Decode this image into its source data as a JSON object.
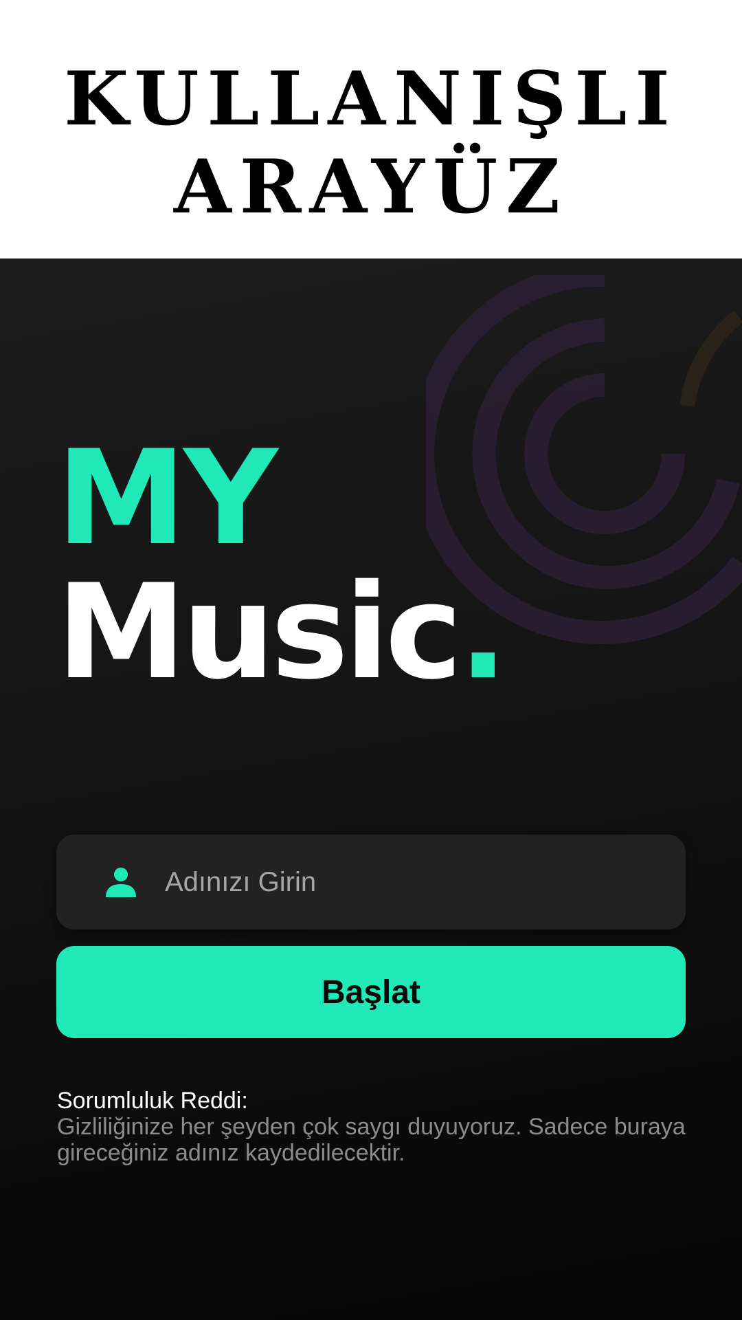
{
  "banner": {
    "title": "KULLANIŞLI\nARAYÜZ"
  },
  "logo": {
    "line1": "MY",
    "line2": "Music",
    "dot": "."
  },
  "name_field": {
    "placeholder": "Adınızı Girin",
    "value": "",
    "icon": "user-icon"
  },
  "start_button": {
    "label": "Başlat"
  },
  "disclaimer": {
    "title": "Sorumluluk Reddi:",
    "text": "Gizliliğinize her şeyden çok saygı duyuyoruz. Sadece buraya gireceğiniz adınız kaydedilecektir."
  },
  "colors": {
    "accent": "#20e8b7",
    "background": "#141414",
    "field": "#222222",
    "banner": "#ffffff"
  }
}
